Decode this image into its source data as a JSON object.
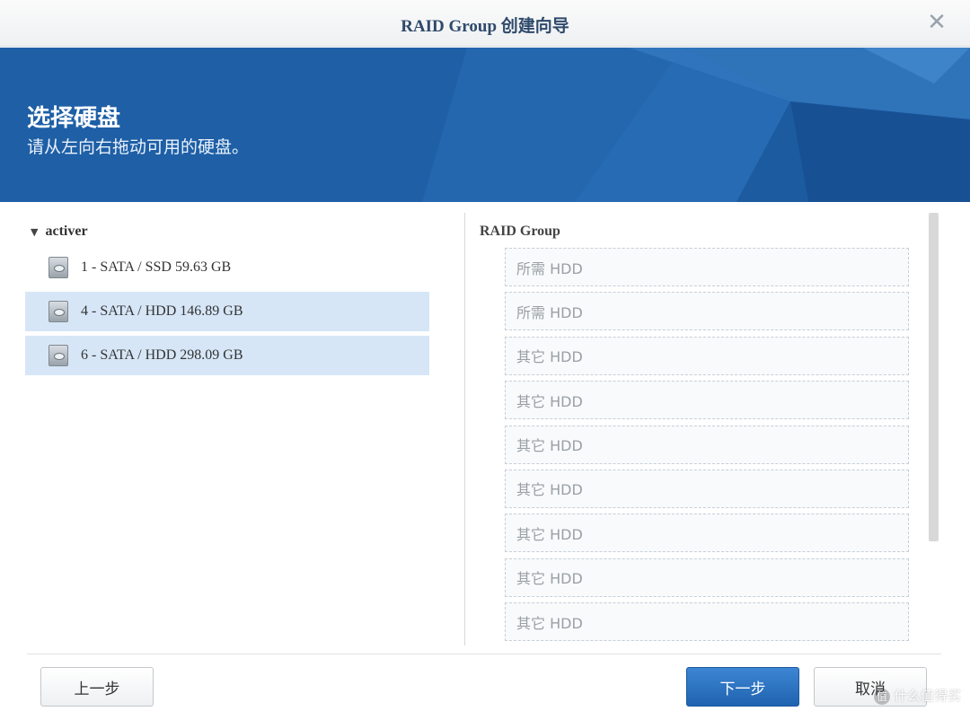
{
  "window": {
    "title": "RAID Group 创建向导",
    "close_icon": "close-icon"
  },
  "banner": {
    "heading": "选择硬盘",
    "subtitle": "请从左向右拖动可用的硬盘。"
  },
  "left": {
    "group_name": "activer",
    "disks": [
      {
        "label": "1 - SATA / SSD 59.63 GB",
        "selected": false
      },
      {
        "label": "4 - SATA / HDD 146.89 GB",
        "selected": true
      },
      {
        "label": "6 - SATA / HDD 298.09 GB",
        "selected": true
      }
    ]
  },
  "right": {
    "title": "RAID Group",
    "slots": [
      "所需 HDD",
      "所需 HDD",
      "其它 HDD",
      "其它 HDD",
      "其它 HDD",
      "其它 HDD",
      "其它 HDD",
      "其它 HDD",
      "其它 HDD"
    ]
  },
  "footer": {
    "back_label": "上一步",
    "next_label": "下一步",
    "cancel_label": "取消"
  },
  "watermark": {
    "badge": "值",
    "text": "什么值得买"
  },
  "colors": {
    "banner_blue": "#1e5fa6",
    "primary_button": "#1f63b0",
    "selected_row": "#d6e6f7"
  }
}
